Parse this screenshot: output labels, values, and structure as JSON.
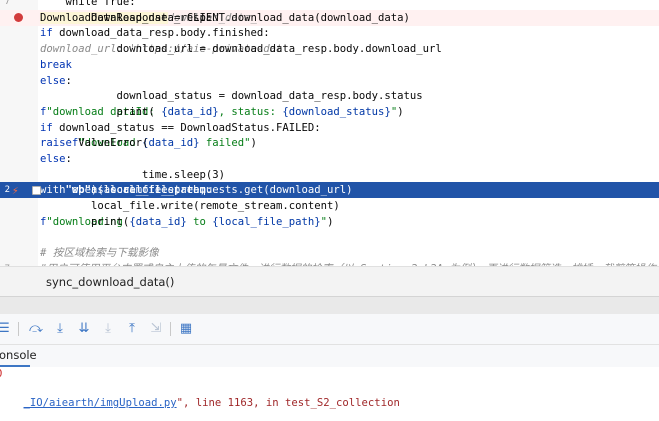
{
  "editor": {
    "lines": [
      {
        "id": "l0",
        "indent": 0,
        "kind": "plain",
        "segments": [
          {
            "t": "    while True:",
            "c": "code"
          }
        ]
      },
      {
        "id": "l1",
        "indent": 0,
        "kind": "error",
        "segments": [
          {
            "t": "        download_data_resp: ",
            "c": "code"
          },
          {
            "t": "DownloadDataResponse",
            "c": "typehl"
          },
          {
            "t": " = CLIENT.download_data(download_data)  ",
            "c": "code"
          },
          {
            "t": "download_data_",
            "c": "hint"
          }
        ]
      },
      {
        "id": "l2",
        "segments": [
          {
            "t": "        ",
            "c": "code"
          },
          {
            "t": "if",
            "c": "kw"
          },
          {
            "t": " download_data_resp.body.finished:",
            "c": "code"
          }
        ]
      },
      {
        "id": "l3",
        "segments": [
          {
            "t": "            download_url = download_data_resp.body.download_url  ",
            "c": "code"
          },
          {
            "t": "download_url: 'https://aie-private-dat",
            "c": "hint"
          }
        ]
      },
      {
        "id": "l4",
        "segments": [
          {
            "t": "            ",
            "c": "code"
          },
          {
            "t": "break",
            "c": "kw"
          }
        ]
      },
      {
        "id": "l5",
        "segments": [
          {
            "t": "        ",
            "c": "code"
          },
          {
            "t": "else",
            "c": "kw"
          },
          {
            "t": ":",
            "c": "code"
          }
        ]
      },
      {
        "id": "l6",
        "segments": [
          {
            "t": "            download_status = download_data_resp.body.status",
            "c": "code"
          }
        ]
      },
      {
        "id": "l7",
        "segments": [
          {
            "t": "            print(",
            "c": "code"
          },
          {
            "t": "f",
            "c": "fpre"
          },
          {
            "t": "\"download dataId: ",
            "c": "str"
          },
          {
            "t": "{data_id}",
            "c": "brace"
          },
          {
            "t": ", status: ",
            "c": "str"
          },
          {
            "t": "{download_status}",
            "c": "brace"
          },
          {
            "t": "\"",
            "c": "str"
          },
          {
            "t": ")",
            "c": "code"
          }
        ]
      },
      {
        "id": "l8",
        "segments": [
          {
            "t": "            ",
            "c": "code"
          },
          {
            "t": "if",
            "c": "kw"
          },
          {
            "t": " download_status == DownloadStatus.FAILED:",
            "c": "code"
          }
        ]
      },
      {
        "id": "l9",
        "segments": [
          {
            "t": "                ",
            "c": "code"
          },
          {
            "t": "raise",
            "c": "kw"
          },
          {
            "t": " ValueError(",
            "c": "code"
          },
          {
            "t": "f",
            "c": "fpre"
          },
          {
            "t": "\"download ",
            "c": "str"
          },
          {
            "t": "{data_id}",
            "c": "brace"
          },
          {
            "t": " failed\"",
            "c": "str"
          },
          {
            "t": ")",
            "c": "code"
          }
        ]
      },
      {
        "id": "l10",
        "segments": [
          {
            "t": "            ",
            "c": "code"
          },
          {
            "t": "else",
            "c": "kw"
          },
          {
            "t": ":",
            "c": "code"
          }
        ]
      },
      {
        "id": "l11",
        "segments": [
          {
            "t": "                time.sleep(3)",
            "c": "code"
          }
        ]
      },
      {
        "id": "l12",
        "kind": "selected",
        "segments": [
          {
            "t": "    ",
            "c": "code"
          },
          {
            "t": "with",
            "c": "kw"
          },
          {
            "t": " open(local_file_path, ",
            "c": "code"
          },
          {
            "t": "\"wb\"",
            "c": "str"
          },
          {
            "t": ") ",
            "c": "code"
          },
          {
            "t": "as",
            "c": "kw"
          },
          {
            "t": " local_file, requests.get(download_url) ",
            "c": "code"
          },
          {
            "t": "as",
            "c": "kw"
          },
          {
            "t": " remote_stream:",
            "c": "code"
          }
        ]
      },
      {
        "id": "l13",
        "segments": [
          {
            "t": "        local_file.write(remote_stream.content)",
            "c": "code"
          }
        ]
      },
      {
        "id": "l14",
        "segments": [
          {
            "t": "        print(",
            "c": "code"
          },
          {
            "t": "f",
            "c": "fpre"
          },
          {
            "t": "\"downloading ",
            "c": "str"
          },
          {
            "t": "{data_id}",
            "c": "brace"
          },
          {
            "t": " to ",
            "c": "str"
          },
          {
            "t": "{local_file_path}",
            "c": "brace"
          },
          {
            "t": "\"",
            "c": "str"
          },
          {
            "t": ")",
            "c": "code"
          }
        ]
      },
      {
        "id": "l15",
        "segments": [
          {
            "t": "",
            "c": "code"
          }
        ]
      },
      {
        "id": "l16",
        "segments": [
          {
            "t": "# 按区域检索与下载影像",
            "c": "cmt"
          }
        ]
      },
      {
        "id": "l17",
        "segments": [
          {
            "t": "#用户可使用平台内置或自主上传的矢量文件，进行数据的检索（以 Sentine-2 L2A 为例），再进行数据筛选、排插、裁剪等操作后",
            "c": "cmt"
          }
        ]
      }
    ],
    "gutter_numbers": [
      "7",
      "2",
      "7"
    ]
  },
  "breadcrumb": {
    "label": "sync_download_data()"
  },
  "toolbar": {
    "icons": [
      {
        "name": "menu-icon",
        "glyph": "☰",
        "dim": false
      },
      {
        "name": "step-over-icon",
        "glyph": "⤼",
        "dim": false
      },
      {
        "name": "step-into-icon",
        "glyph": "⤓",
        "dim": false
      },
      {
        "name": "step-into-my-code-icon",
        "glyph": "⇊",
        "dim": false
      },
      {
        "name": "force-step-into-icon",
        "glyph": "⤓",
        "dim": true
      },
      {
        "name": "step-out-icon",
        "glyph": "⤒",
        "dim": false
      },
      {
        "name": "run-to-cursor-icon",
        "glyph": "⇲",
        "dim": true
      },
      {
        "name": "evaluate-expression-icon",
        "glyph": "▦",
        "dim": false
      }
    ]
  },
  "console_tab": {
    "label": "onsole"
  },
  "console": {
    "line1": "0",
    "line2_link": "_IO/aiearth/imgUpload.py",
    "line2_rest": "\", line 1163, in test_S2_collection"
  }
}
